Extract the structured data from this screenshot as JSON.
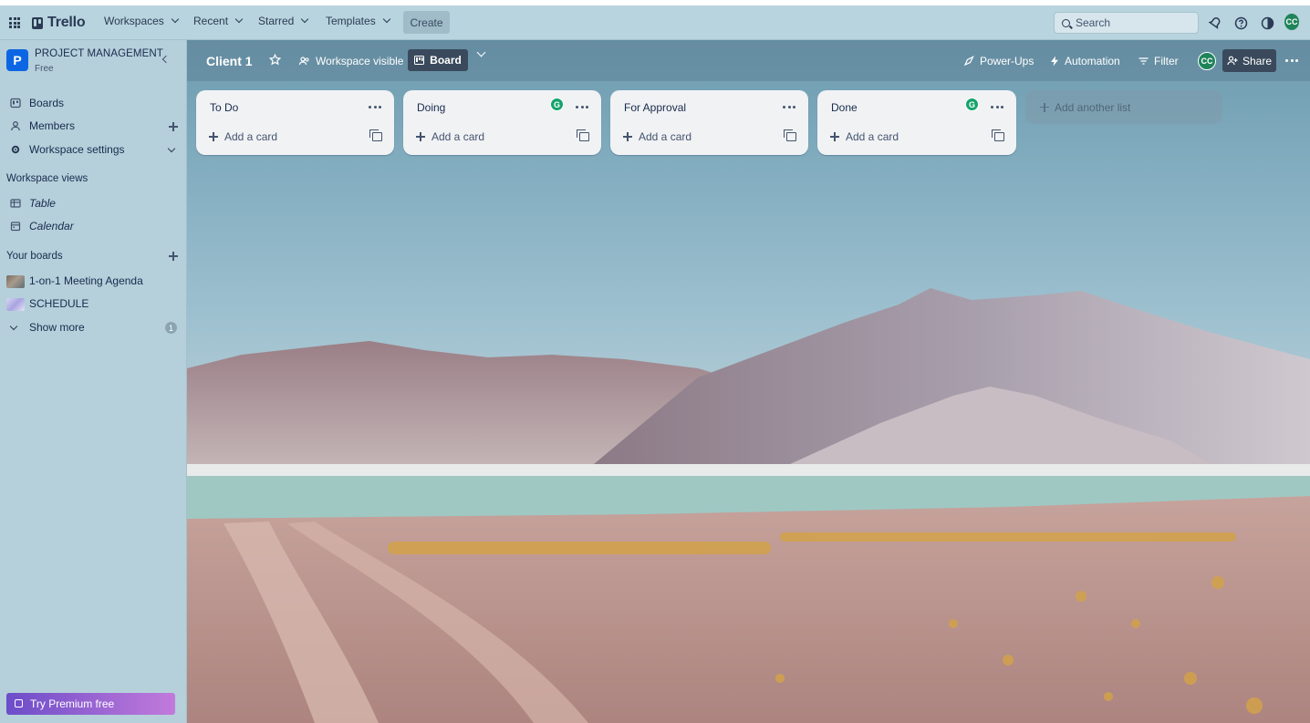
{
  "app": {
    "name": "Trello"
  },
  "topnav": {
    "menus": [
      {
        "label": "Workspaces"
      },
      {
        "label": "Recent"
      },
      {
        "label": "Starred"
      },
      {
        "label": "Templates"
      }
    ],
    "create_label": "Create",
    "search_placeholder": "Search",
    "avatar_initials": "CC"
  },
  "sidebar": {
    "workspace_initial": "P",
    "workspace_name": "PROJECT MANAGEMENT",
    "workspace_plan": "Free",
    "items": [
      {
        "label": "Boards",
        "icon": "boards-icon"
      },
      {
        "label": "Members",
        "icon": "member-icon"
      },
      {
        "label": "Workspace settings",
        "icon": "gear-icon"
      }
    ],
    "views_heading": "Workspace views",
    "views": [
      {
        "label": "Table",
        "icon": "table-icon"
      },
      {
        "label": "Calendar",
        "icon": "calendar-icon"
      }
    ],
    "your_boards_heading": "Your boards",
    "boards": [
      {
        "label": "1-on-1 Meeting Agenda"
      },
      {
        "label": "SCHEDULE"
      }
    ],
    "show_more_label": "Show more",
    "show_more_count": "1",
    "premium_label": "Try Premium free"
  },
  "board": {
    "title": "Client 1",
    "visibility_label": "Workspace visible",
    "view_label": "Board",
    "powerups_label": "Power-Ups",
    "automation_label": "Automation",
    "filter_label": "Filter",
    "member_initials": "CC",
    "share_label": "Share",
    "lists": [
      {
        "title": "To Do",
        "add_card_label": "Add a card",
        "has_badge": false
      },
      {
        "title": "Doing",
        "add_card_label": "Add a card",
        "has_badge": true
      },
      {
        "title": "For Approval",
        "add_card_label": "Add a card",
        "has_badge": false
      },
      {
        "title": "Done",
        "add_card_label": "Add a card",
        "has_badge": true
      }
    ],
    "badge_letter": "G",
    "add_list_label": "Add another list"
  },
  "colors": {
    "topnav_bg": "#b8d4de",
    "sidebar_bg": "#b5d0db",
    "workspace_tile": "#0c66e4",
    "avatar_green": "#1f845a",
    "list_bg": "#f1f2f4",
    "premium_gradient_start": "#6c4dc9",
    "premium_gradient_end": "#c27adb"
  }
}
